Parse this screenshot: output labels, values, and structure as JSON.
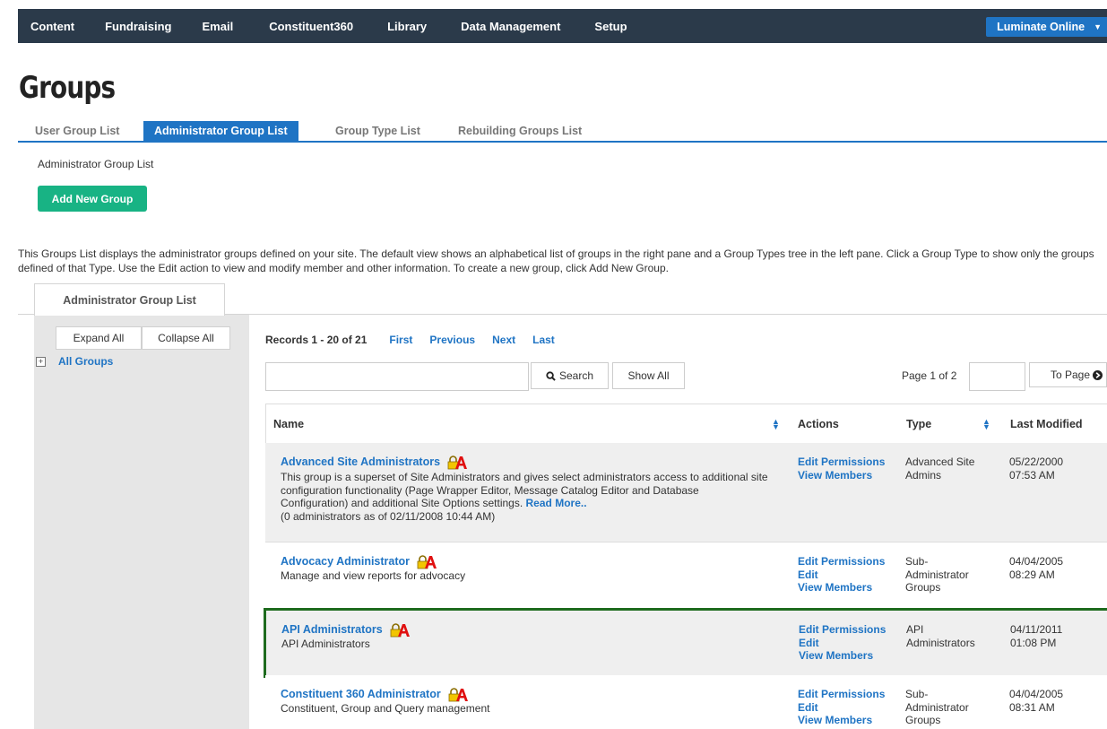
{
  "nav": {
    "items": [
      "Content",
      "Fundraising",
      "Email",
      "Constituent360",
      "Library",
      "Data Management",
      "Setup"
    ],
    "account": "Luminate Online"
  },
  "page": {
    "title": "Groups"
  },
  "subtabs": [
    "User Group List",
    "Administrator Group List",
    "Group Type List",
    "Rebuilding Groups List"
  ],
  "breadcrumb": "Administrator Group List",
  "add_button": "Add New Group",
  "description": "This Groups List displays the administrator groups defined on your site. The default view shows an alphabetical list of groups in the right pane and a Group Types tree in the left pane. Click a Group Type to show only the groups defined of that Type. Use the Edit action to view and modify member and other information. To create a new group, click Add New Group.",
  "panel_tab": "Administrator Group List",
  "tree": {
    "expand": "Expand All",
    "collapse": "Collapse All",
    "root": "All Groups"
  },
  "records": {
    "count": "Records 1 - 20 of 21",
    "first": "First",
    "previous": "Previous",
    "next": "Next",
    "last": "Last"
  },
  "search": {
    "value": "",
    "button": "Search",
    "show_all": "Show All",
    "page_info": "Page 1 of 2",
    "page_value": "",
    "to_page": "To Page"
  },
  "table": {
    "headers": {
      "name": "Name",
      "actions": "Actions",
      "type": "Type",
      "modified": "Last Modified"
    },
    "rows": [
      {
        "name": "Advanced Site Administrators",
        "desc": "This group is a superset of Site Administrators and gives select administrators access to additional site configuration functionality (Page Wrapper Editor, Message Catalog Editor and Database Configuration) and additional Site Options settings.",
        "read_more": "Read More..",
        "note": "(0 administrators as of 02/11/2008 10:44 AM)",
        "actions": [
          "Edit Permissions",
          "View Members"
        ],
        "type": "Advanced Site Admins",
        "date": "05/22/2000",
        "time": "07:53 AM"
      },
      {
        "name": "Advocacy Administrator",
        "desc": "Manage and view reports for advocacy",
        "actions": [
          "Edit Permissions",
          "Edit",
          "View Members"
        ],
        "type": "Sub-Administrator Groups",
        "date": "04/04/2005",
        "time": "08:29 AM"
      },
      {
        "name": "API Administrators",
        "desc": "API Administrators",
        "actions": [
          "Edit Permissions",
          "Edit",
          "View Members"
        ],
        "type": "API Administrators",
        "date": "04/11/2011",
        "time": "01:08 PM"
      },
      {
        "name": "Constituent 360 Administrator",
        "desc": "Constituent, Group and Query management",
        "actions": [
          "Edit Permissions",
          "Edit",
          "View Members"
        ],
        "type": "Sub-Administrator Groups",
        "date": "04/04/2005",
        "time": "08:31 AM"
      }
    ]
  }
}
